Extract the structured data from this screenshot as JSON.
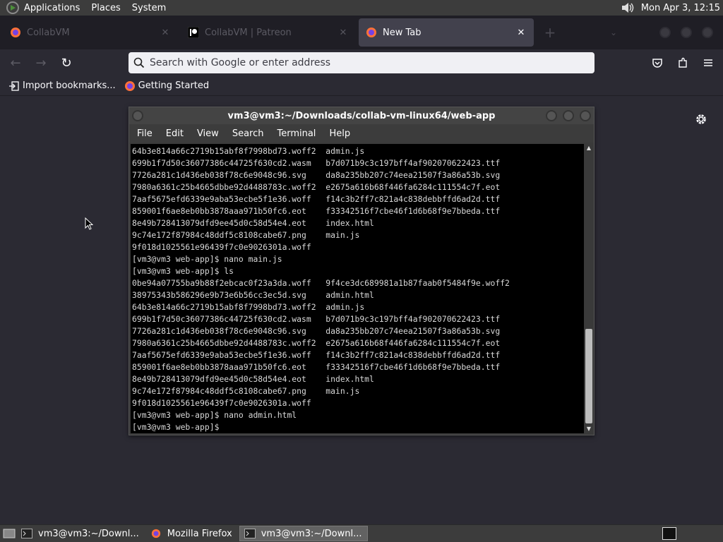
{
  "panel": {
    "menus": [
      "Applications",
      "Places",
      "System"
    ],
    "clock": "Mon Apr  3, 12:15"
  },
  "browser": {
    "tabs": [
      {
        "title": "CollabVM",
        "close": "✕"
      },
      {
        "title": "CollabVM | Patreon",
        "close": "✕"
      },
      {
        "title": "New Tab",
        "close": "✕"
      }
    ],
    "new_tab": "+",
    "url_placeholder": "Search with Google or enter address",
    "bookmarks": [
      "Import bookmarks...",
      "Getting Started"
    ]
  },
  "terminal": {
    "title": "vm3@vm3:~/Downloads/collab-vm-linux64/web-app",
    "menu": [
      "File",
      "Edit",
      "View",
      "Search",
      "Terminal",
      "Help"
    ],
    "lines": [
      "64b3e814a66c2719b15abf8f7998bd73.woff2  admin.js",
      "699b1f7d50c36077386c44725f630cd2.wasm   b7d071b9c3c197bff4af902070622423.ttf",
      "7726a281c1d436eb038f78c6e9048c96.svg    da8a235bb207c74eea21507f3a86a53b.svg",
      "7980a6361c25b4665dbbe92d4488783c.woff2  e2675a616b68f446fa6284c111554c7f.eot",
      "7aaf5675efd6339e9aba53ecbe5f1e36.woff   f14c3b2ff7c821a4c838debbffd6ad2d.ttf",
      "859001f6ae8eb0bb3878aaa971b50fc6.eot    f33342516f7cbe46f1d6b68f9e7bbeda.ttf",
      "8e49b728413079dfd9ee45d0c58d54e4.eot    index.html",
      "9c74e172f87984c48ddf5c8108cabe67.png    main.js",
      "9f018d1025561e96439f7c0e9026301a.woff",
      "[vm3@vm3 web-app]$ nano main.js",
      "[vm3@vm3 web-app]$ ls",
      "0be94a07755ba9b88f2ebcac0f23a3da.woff   9f4ce3dc689981a1b87faab0f5484f9e.woff2",
      "38975343b586296e9b73e6b56cc3ec5d.svg    admin.html",
      "64b3e814a66c2719b15abf8f7998bd73.woff2  admin.js",
      "699b1f7d50c36077386c44725f630cd2.wasm   b7d071b9c3c197bff4af902070622423.ttf",
      "7726a281c1d436eb038f78c6e9048c96.svg    da8a235bb207c74eea21507f3a86a53b.svg",
      "7980a6361c25b4665dbbe92d4488783c.woff2  e2675a616b68f446fa6284c111554c7f.eot",
      "7aaf5675efd6339e9aba53ecbe5f1e36.woff   f14c3b2ff7c821a4c838debbffd6ad2d.ttf",
      "859001f6ae8eb0bb3878aaa971b50fc6.eot    f33342516f7cbe46f1d6b68f9e7bbeda.ttf",
      "8e49b728413079dfd9ee45d0c58d54e4.eot    index.html",
      "9c74e172f87984c48ddf5c8108cabe67.png    main.js",
      "9f018d1025561e96439f7c0e9026301a.woff",
      "[vm3@vm3 web-app]$ nano admin.html",
      "[vm3@vm3 web-app]$ "
    ]
  },
  "taskbar": {
    "tasks": [
      "vm3@vm3:~/Downl...",
      "Mozilla Firefox",
      "vm3@vm3:~/Downl..."
    ]
  }
}
